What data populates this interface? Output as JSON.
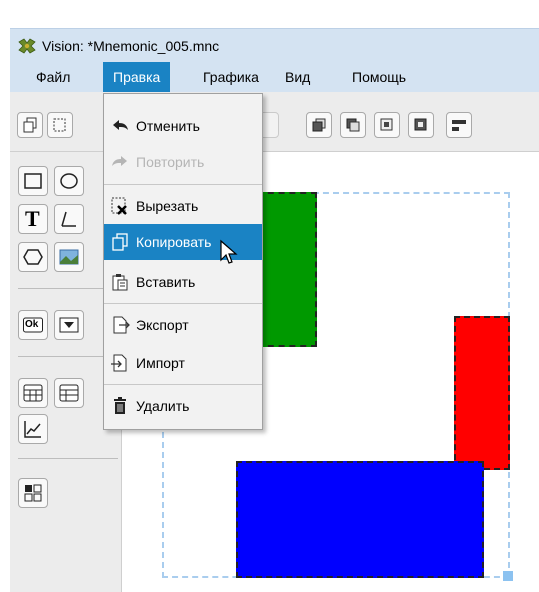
{
  "window": {
    "title": "Vision: *Mnemonic_005.mnc"
  },
  "menubar": {
    "items": [
      {
        "label": "Файл",
        "active": false
      },
      {
        "label": "Правка",
        "active": true
      },
      {
        "label": "Графика",
        "active": false
      },
      {
        "label": "Вид",
        "active": false
      },
      {
        "label": "Помощь",
        "active": false
      }
    ]
  },
  "edit_menu": {
    "items": [
      {
        "label": "Отменить",
        "icon": "undo-icon",
        "enabled": true
      },
      {
        "label": "Повторить",
        "icon": "redo-icon",
        "enabled": false
      },
      {
        "label": "Вырезать",
        "icon": "cut-icon",
        "enabled": true
      },
      {
        "label": "Копировать",
        "icon": "copy-icon",
        "enabled": true,
        "highlighted": true
      },
      {
        "label": "Вставить",
        "icon": "paste-icon",
        "enabled": true
      },
      {
        "label": "Экспорт",
        "icon": "export-icon",
        "enabled": true
      },
      {
        "label": "Импорт",
        "icon": "import-icon",
        "enabled": true
      },
      {
        "label": "Удалить",
        "icon": "trash-icon",
        "enabled": true
      }
    ]
  },
  "toolbox": {
    "text_tool_glyph": "T",
    "ok_button_label": "Ok"
  },
  "colors": {
    "accent": "#1a83c4",
    "title_bg": "#d4e3f2",
    "shape_green": "#009900",
    "shape_red": "#ff0000",
    "shape_blue": "#0000ff",
    "selection": "#a9cdee"
  }
}
